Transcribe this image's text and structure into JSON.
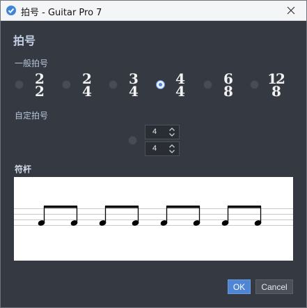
{
  "window": {
    "title": "拍号 - Guitar Pro 7",
    "icon": "guitar-pro-icon",
    "close_icon": "close-icon"
  },
  "dialog": {
    "heading": "拍号"
  },
  "general": {
    "label": "一般拍号",
    "options": [
      {
        "top": "2",
        "bottom": "2",
        "selected": false
      },
      {
        "top": "2",
        "bottom": "4",
        "selected": false
      },
      {
        "top": "3",
        "bottom": "4",
        "selected": false
      },
      {
        "top": "4",
        "bottom": "4",
        "selected": true
      },
      {
        "top": "6",
        "bottom": "8",
        "selected": false
      },
      {
        "top": "12",
        "bottom": "8",
        "selected": false
      }
    ]
  },
  "custom": {
    "label": "自定拍号",
    "numerator": "4",
    "denominator": "4",
    "selected": false
  },
  "beaming": {
    "label": "符杆"
  },
  "buttons": {
    "ok": "OK",
    "cancel": "Cancel"
  },
  "colors": {
    "background": "#353942",
    "accent": "#4f86d4",
    "heading": "#c6d2e8"
  }
}
